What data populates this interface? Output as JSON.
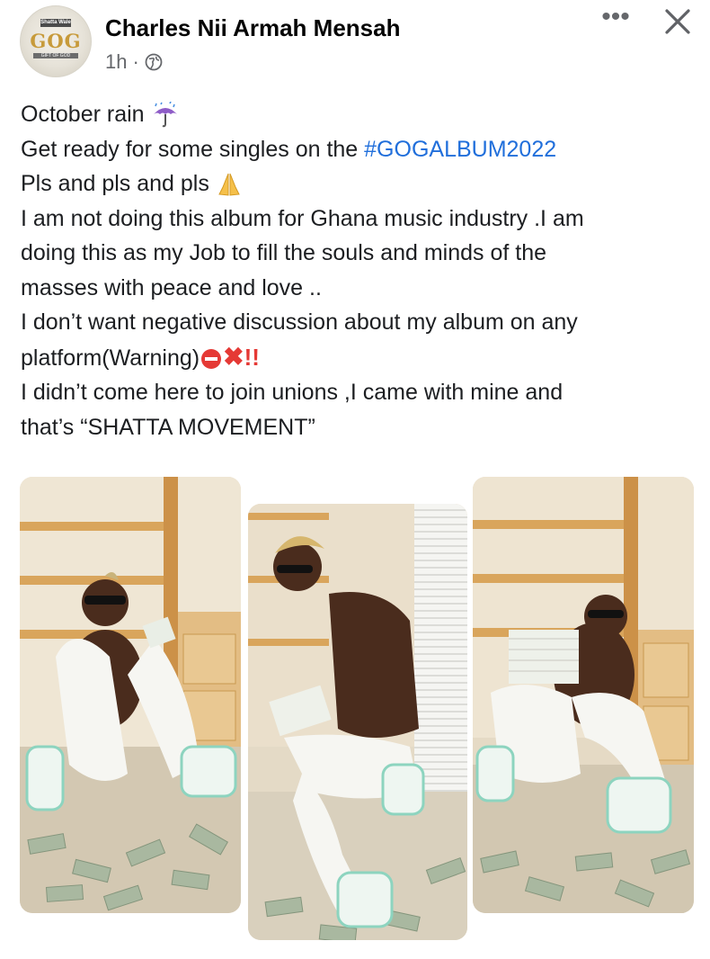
{
  "post": {
    "author": "Charles Nii Armah Mensah",
    "time": "1h",
    "separator": "·",
    "privacy_icon": "globe-icon",
    "avatar_text": {
      "top": "Shatta Wale",
      "main": "GOG",
      "strip": "GIFT OF GOD"
    },
    "more_icon": "more-horizontal-icon",
    "more_label": "•••",
    "close_icon": "close-icon",
    "text_lines": [
      "October rain",
      "Get ready for some singles on the ",
      "Pls and pls and pls",
      "I am not doing this album for Ghana music industry .I am",
      "doing this as my Job to fill the souls and minds of the",
      "masses with peace and love ..",
      "I don’t want negative discussion about my album on any",
      "platform(Warning)",
      "I didn’t come here to join unions ,I came with mine and",
      "that’s “SHATTA MOVEMENT”"
    ],
    "hashtag": "#GOGALBUM2022",
    "emoji_x": "✖",
    "emoji_bang": "!!",
    "photos": [
      {
        "name": "photo-1"
      },
      {
        "name": "photo-2"
      },
      {
        "name": "photo-3"
      }
    ],
    "colors": {
      "hashtag": "#216fdb",
      "meta": "#65676b",
      "warning": "#e53935"
    }
  }
}
